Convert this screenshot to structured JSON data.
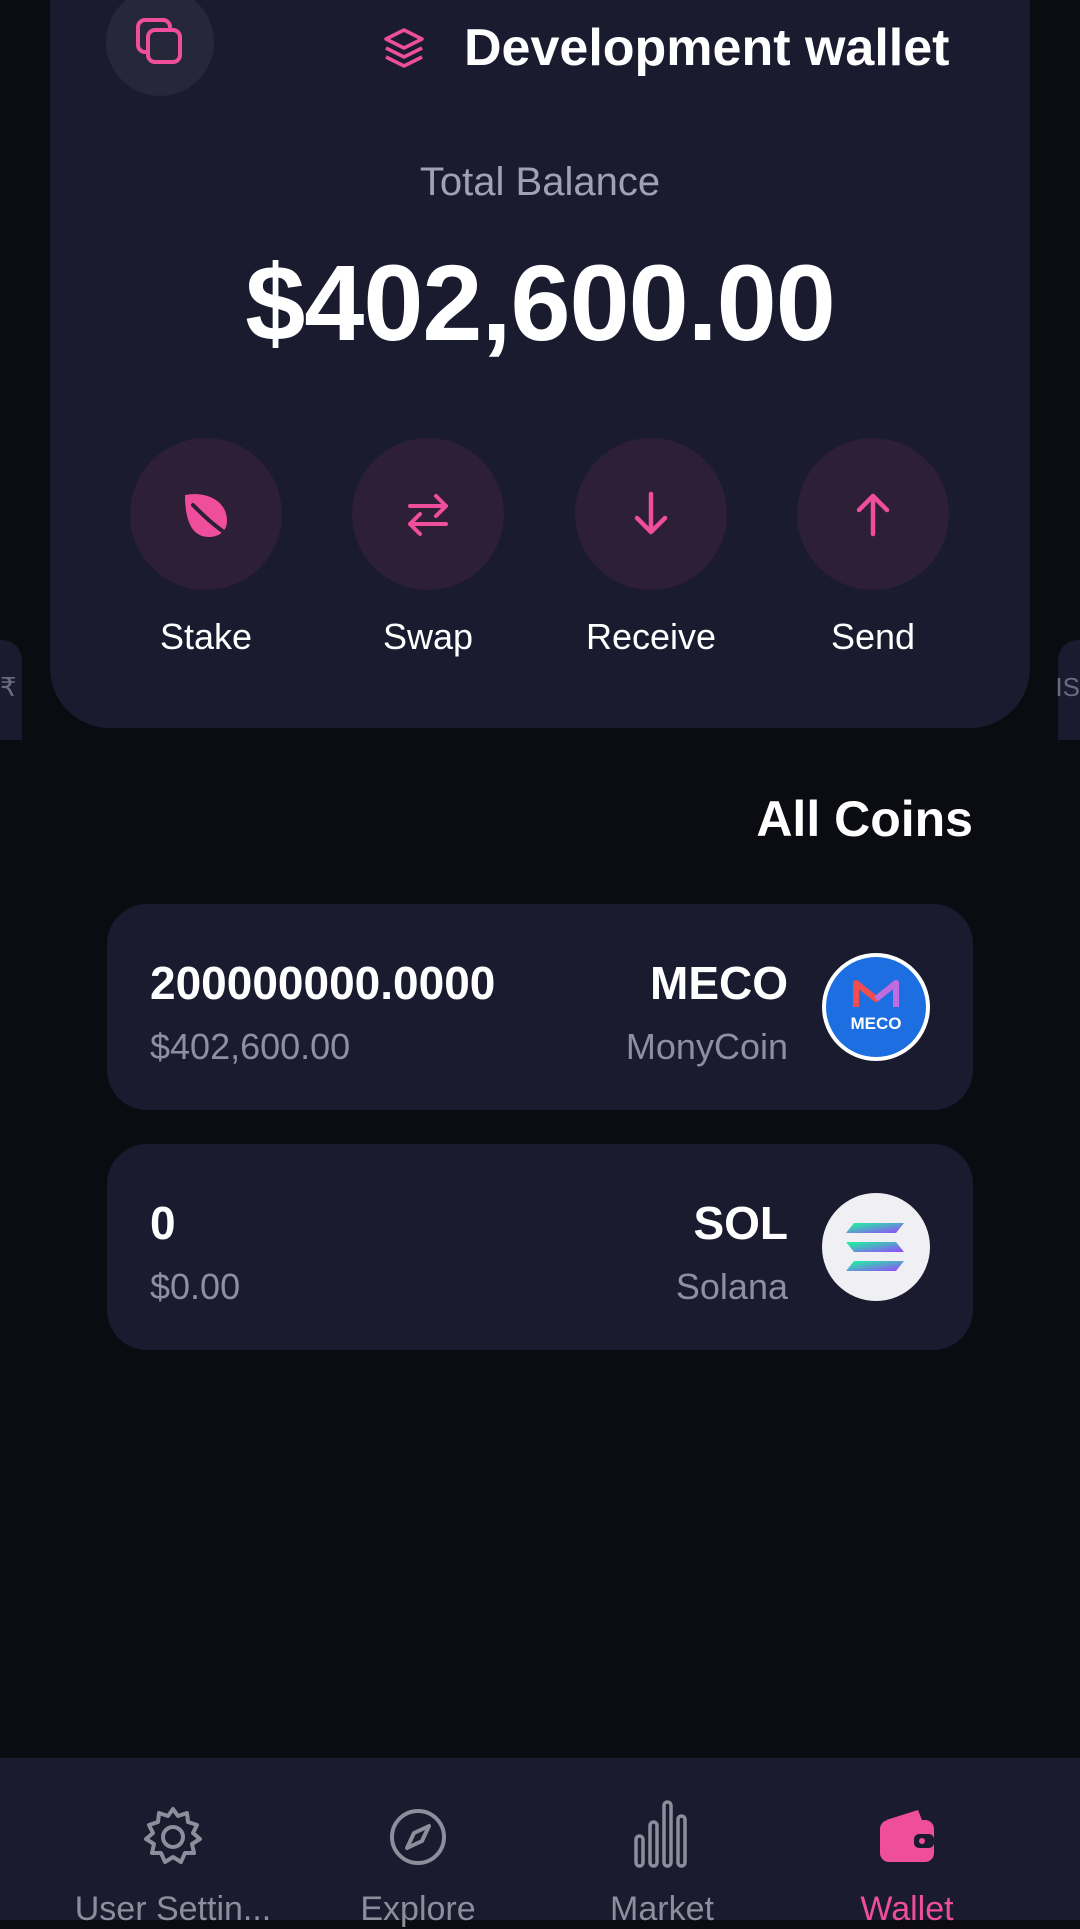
{
  "header": {
    "wallet_name": "Development wallet",
    "balance_label": "Total Balance",
    "balance_value": "$402,600.00"
  },
  "actions": [
    {
      "label": "Stake",
      "icon": "leaf-icon"
    },
    {
      "label": "Swap",
      "icon": "swap-arrows-icon"
    },
    {
      "label": "Receive",
      "icon": "arrow-down-icon"
    },
    {
      "label": "Send",
      "icon": "arrow-up-icon"
    }
  ],
  "side_peek": {
    "left": "₹",
    "right": "IS"
  },
  "coins_section": {
    "title": "All Coins",
    "coins": [
      {
        "amount": "200000000.0000",
        "usd": "$402,600.00",
        "symbol": "MECO",
        "name": "MonyCoin",
        "logo_text": "MECO",
        "icon": "meco-logo"
      },
      {
        "amount": "0",
        "usd": "$0.00",
        "symbol": "SOL",
        "name": "Solana",
        "icon": "solana-logo"
      }
    ]
  },
  "bottom_nav": {
    "items": [
      {
        "label": "User Settin...",
        "icon": "gear-icon"
      },
      {
        "label": "Explore",
        "icon": "compass-icon"
      },
      {
        "label": "Market",
        "icon": "bar-chart-icon"
      },
      {
        "label": "Wallet",
        "icon": "wallet-icon",
        "active": true
      }
    ]
  },
  "colors": {
    "accent": "#ee4e9b",
    "background": "#0b0b12",
    "panel": "#1a1b2e",
    "action_circle": "#2d1f35",
    "muted_text": "#8e8fa3"
  }
}
